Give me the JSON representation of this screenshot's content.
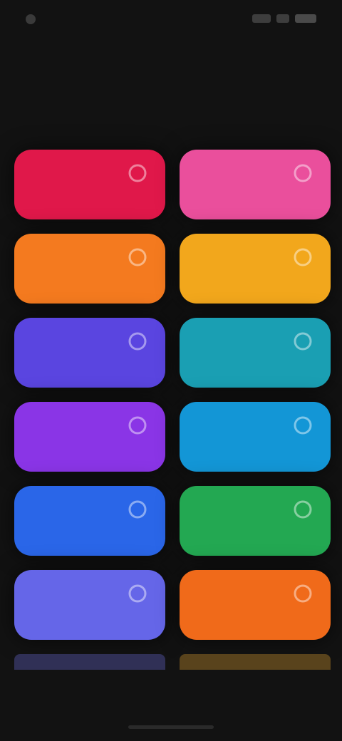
{
  "status_bar": {
    "time": "",
    "icons": [
      "signal-icon",
      "wifi-icon",
      "battery-icon"
    ]
  },
  "page": {
    "title": ""
  },
  "tiles": [
    {
      "label": "",
      "color": "#E0184A",
      "icon": "circle-icon"
    },
    {
      "label": "",
      "color": "#EA4F9C",
      "icon": "circle-icon"
    },
    {
      "label": "",
      "color": "#F47A1F",
      "icon": "circle-icon"
    },
    {
      "label": "",
      "color": "#F2A71C",
      "icon": "circle-icon"
    },
    {
      "label": "",
      "color": "#5A45E0",
      "icon": "circle-icon"
    },
    {
      "label": "",
      "color": "#1A9FB3",
      "icon": "circle-icon"
    },
    {
      "label": "",
      "color": "#8A35E6",
      "icon": "circle-icon"
    },
    {
      "label": "",
      "color": "#1396D6",
      "icon": "circle-icon"
    },
    {
      "label": "",
      "color": "#2A66E8",
      "icon": "circle-icon"
    },
    {
      "label": "",
      "color": "#23A852",
      "icon": "circle-icon"
    },
    {
      "label": "",
      "color": "#6566E8",
      "icon": "circle-icon"
    },
    {
      "label": "",
      "color": "#F06A1A",
      "icon": "circle-icon"
    }
  ],
  "partial_tiles": [
    {
      "color": "#6b6bd6"
    },
    {
      "color": "#e0a030"
    }
  ]
}
